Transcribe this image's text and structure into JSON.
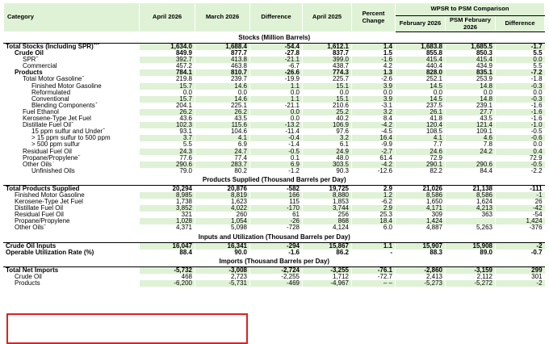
{
  "header": {
    "category": "Category",
    "apr2026": "April 2026",
    "mar2026": "March 2026",
    "difference": "Difference",
    "apr2025": "April 2025",
    "percent_change": "Percent Change",
    "wpsr_title": "WPSR to PSM Comparison",
    "feb2026": "February 2026",
    "psm_feb2026": "PSM February 2026",
    "difference2": "Difference"
  },
  "sections": {
    "stocks": "Stocks (Million Barrels)",
    "products_supplied": "Products Supplied (Thousand Barrels per Day)",
    "inputs": "Inputs and Utilization (Thousand Barrels per Day)",
    "imports": "Imports (Thousand Barrels per Day)"
  },
  "stocks_rows": [
    {
      "label": "Total Stocks (Including SPR)",
      "sup": "1,2",
      "v": [
        "1,634.0",
        "1,688.4",
        "-54.4",
        "1,612.1",
        "1.4",
        "1,683.8",
        "1,685.5",
        "-1.7"
      ]
    },
    {
      "label": "Crude Oil",
      "sup": "",
      "v": [
        "849.9",
        "877.7",
        "-27.8",
        "837.7",
        "1.5",
        "855.8",
        "850.3",
        "5.5"
      ]
    },
    {
      "label": "SPR",
      "sup": "3",
      "v": [
        "392.7",
        "413.8",
        "-21.1",
        "399.0",
        "-1.6",
        "415.4",
        "415.4",
        "0.0"
      ]
    },
    {
      "label": "Commercial",
      "sup": "",
      "v": [
        "457.2",
        "463.8",
        "-6.7",
        "438.7",
        "4.2",
        "440.4",
        "434.9",
        "5.5"
      ]
    },
    {
      "label": "Products",
      "sup": "",
      "v": [
        "784.1",
        "810.7",
        "-26.6",
        "774.3",
        "1.3",
        "828.0",
        "835.1",
        "-7.2"
      ]
    },
    {
      "label": "Total Motor Gasoline",
      "sup": "1",
      "v": [
        "219.8",
        "239.7",
        "-19.9",
        "225.7",
        "-2.6",
        "252.1",
        "253.9",
        "-1.8"
      ]
    },
    {
      "label": "Finished Motor Gasoline",
      "sup": "",
      "v": [
        "15.7",
        "14.6",
        "1.1",
        "15.1",
        "3.9",
        "14.5",
        "14.8",
        "-0.3"
      ]
    },
    {
      "label": "Reformulated",
      "sup": "",
      "v": [
        "0.0",
        "0.0",
        "0.0",
        "0.0",
        "0.0",
        "0.0",
        "0.0",
        "0.0"
      ]
    },
    {
      "label": "Conventional",
      "sup": "",
      "v": [
        "15.7",
        "14.6",
        "1.1",
        "15.1",
        "3.9",
        "14.5",
        "14.8",
        "-0.3"
      ]
    },
    {
      "label": "Blending Components",
      "sup": "1",
      "v": [
        "204.1",
        "225.1",
        "-21.1",
        "210.6",
        "-3.1",
        "237.5",
        "239.1",
        "-1.6"
      ]
    },
    {
      "label": "Fuel Ethanol",
      "sup": "",
      "v": [
        "26.2",
        "26.2",
        "0.0",
        "25.2",
        "3.2",
        "26.1",
        "27.7",
        "-1.6"
      ]
    },
    {
      "label": "Kerosene-Type Jet Fuel",
      "sup": "",
      "v": [
        "43.6",
        "43.5",
        "0.0",
        "40.2",
        "8.4",
        "41.8",
        "43.5",
        "-1.6"
      ]
    },
    {
      "label": "Distillate Fuel Oil",
      "sup": "1",
      "v": [
        "102.3",
        "115.6",
        "-13.2",
        "106.9",
        "-4.2",
        "120.4",
        "121.4",
        "-1.0"
      ]
    },
    {
      "label": "15 ppm sulfur and Under",
      "sup": "1",
      "v": [
        "93.1",
        "104.6",
        "-11.4",
        "97.6",
        "-4.5",
        "108.5",
        "109.1",
        "-0.5"
      ]
    },
    {
      "label": "> 15 ppm sulfur to 500 ppm",
      "sup": "",
      "v": [
        "3.7",
        "4.1",
        "-0.4",
        "3.2",
        "16.4",
        "4.1",
        "4.6",
        "-0.6"
      ]
    },
    {
      "label": "> 500 ppm sulfur",
      "sup": "",
      "v": [
        "5.5",
        "6.9",
        "-1.4",
        "6.1",
        "-9.9",
        "7.7",
        "7.8",
        "0.0"
      ]
    },
    {
      "label": "Residual Fuel Oil",
      "sup": "",
      "v": [
        "24.3",
        "24.7",
        "-0.5",
        "24.9",
        "-2.7",
        "24.6",
        "24.2",
        "0.4"
      ]
    },
    {
      "label": "Propane/Propylene",
      "sup": "2",
      "v": [
        "77.6",
        "77.4",
        "0.1",
        "48.0",
        "61.4",
        "72.9",
        "",
        "72.9"
      ]
    },
    {
      "label": "Other Oils",
      "sup": "4",
      "v": [
        "290.6",
        "283.7",
        "6.9",
        "303.5",
        "-4.2",
        "290.1",
        "290.6",
        "-0.5"
      ]
    },
    {
      "label": "Unfinished Oils",
      "sup": "",
      "v": [
        "79.0",
        "80.2",
        "-1.2",
        "90.3",
        "-12.6",
        "82.2",
        "84.4",
        "-2.2"
      ]
    }
  ],
  "supplied_rows": [
    {
      "label": "Total Products Supplied",
      "sup": "",
      "v": [
        "20,294",
        "20,876",
        "-582",
        "19,725",
        "2.9",
        "21,026",
        "21,138",
        "-111"
      ]
    },
    {
      "label": "Finished Motor Gasoline",
      "sup": "",
      "v": [
        "8,985",
        "8,819",
        "166",
        "8,880",
        "1.2",
        "8,586",
        "8,586",
        "-1"
      ]
    },
    {
      "label": "Kerosene-Type Jet Fuel",
      "sup": "",
      "v": [
        "1,738",
        "1,623",
        "115",
        "1,853",
        "-6.2",
        "1,650",
        "1,624",
        "26"
      ]
    },
    {
      "label": "Distillate Fuel Oil",
      "sup": "",
      "v": [
        "3,852",
        "4,022",
        "-170",
        "3,744",
        "2.9",
        "4,171",
        "4,213",
        "-42"
      ]
    },
    {
      "label": "Residual Fuel Oil",
      "sup": "",
      "v": [
        "321",
        "260",
        "61",
        "256",
        "25.3",
        "309",
        "363",
        "-54"
      ]
    },
    {
      "label": "Propane/Propylene",
      "sup": "",
      "v": [
        "1,028",
        "1,054",
        "-26",
        "868",
        "18.4",
        "1,424",
        "",
        "1,424"
      ]
    },
    {
      "label": "Other Oils",
      "sup": "5",
      "v": [
        "4,371",
        "5,098",
        "-728",
        "4,124",
        "6.0",
        "4,887",
        "5,263",
        "-376"
      ]
    }
  ],
  "inputs_rows": [
    {
      "label": "Crude Oil Inputs",
      "sup": "",
      "v": [
        "16,047",
        "16,341",
        "-294",
        "15,867",
        "1.1",
        "15,907",
        "15,908",
        "-2"
      ]
    },
    {
      "label": "Operable Utilization Rate (%)",
      "sup": "",
      "v": [
        "88.4",
        "90.0",
        "-1.6",
        "86.2",
        "-",
        "88.3",
        "89.0",
        "-0.7"
      ]
    }
  ],
  "imports_rows": [
    {
      "label": "Total Net Imports",
      "sup": "",
      "v": [
        "-5,732",
        "-3,008",
        "-2,724",
        "-3,255",
        "-76.1",
        "-2,860",
        "-3,159",
        "299"
      ]
    },
    {
      "label": "Crude Oil",
      "sup": "",
      "v": [
        "468",
        "2,723",
        "-2,255",
        "1,712",
        "-72.7",
        "2,413",
        "2,112",
        "301"
      ]
    },
    {
      "label": "Products",
      "sup": "",
      "v": [
        "-6,200",
        "-5,731",
        "-469",
        "-4,967",
        "– –",
        "-5,273",
        "-5,272",
        "-2"
      ]
    }
  ]
}
